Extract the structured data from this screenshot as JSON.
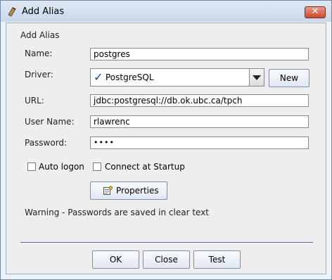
{
  "window": {
    "title": "Add Alias"
  },
  "section_title": "Add Alias",
  "fields": {
    "name": {
      "label": "Name:",
      "value": "postgres"
    },
    "driver": {
      "label": "Driver:",
      "value": "PostgreSQL",
      "new_label": "New"
    },
    "url": {
      "label": "URL:",
      "value": "jdbc:postgresql://db.ok.ubc.ca/tpch"
    },
    "user": {
      "label": "User Name:",
      "value": "rlawrenc"
    },
    "password": {
      "label": "Password:",
      "value": "••••"
    }
  },
  "options": {
    "auto_logon": {
      "label": "Auto logon",
      "checked": false
    },
    "connect_startup": {
      "label": "Connect at Startup",
      "checked": false
    }
  },
  "properties_label": "Properties",
  "warning": "Warning - Passwords are saved in clear text",
  "buttons": {
    "ok": "OK",
    "close": "Close",
    "test": "Test"
  }
}
